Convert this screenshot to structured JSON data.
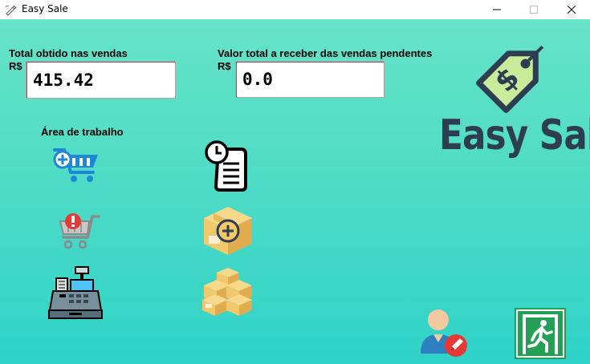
{
  "window": {
    "title": "Easy Sale",
    "icon": "app-pen-icon",
    "controls": [
      "minimize-icon",
      "maximize-icon",
      "close-icon"
    ]
  },
  "labels": {
    "total_sales": "Total obtido nas vendas",
    "currency_1": "R$",
    "pending_total": "Valor total a receber das vendas pendentes",
    "currency_2": "R$",
    "workspace": "Área de trabalho"
  },
  "fields": {
    "total_sales_value": "415.42",
    "pending_value": "0.0"
  },
  "logo": {
    "text": "Easy Sale",
    "symbol": "$",
    "icon": "price-tag-icon"
  },
  "actions": [
    {
      "name": "new-sale-button",
      "icon": "cart-add-icon"
    },
    {
      "name": "pending-sales-button",
      "icon": "cart-alert-icon"
    },
    {
      "name": "cash-register-button",
      "icon": "cash-register-icon"
    },
    {
      "name": "sales-history-button",
      "icon": "clock-document-icon"
    },
    {
      "name": "add-product-button",
      "icon": "box-add-icon"
    },
    {
      "name": "stock-button",
      "icon": "boxes-icon"
    },
    {
      "name": "user-edit-button",
      "icon": "user-edit-icon"
    },
    {
      "name": "exit-button",
      "icon": "exit-icon"
    }
  ],
  "colors": {
    "background_top": "#66e3c8",
    "background_bottom": "#2fd2c8",
    "logo_text": "#2d3e52",
    "tag_fill": "#c8ec9a",
    "cart_blue": "#1e88d6",
    "box_yellow": "#f2c86c",
    "exit_green": "#23a055"
  }
}
